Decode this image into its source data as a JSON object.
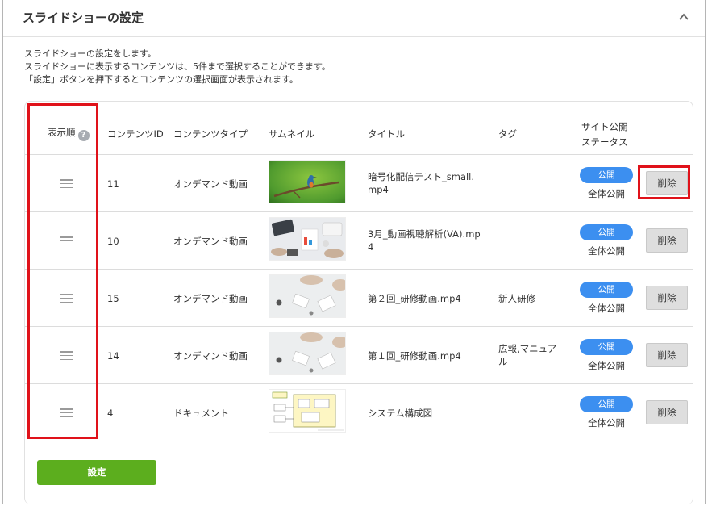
{
  "panel": {
    "title": "スライドショーの設定"
  },
  "description": [
    "スライドショーの設定をします。",
    "スライドショーに表示するコンテンツは、5件まで選択することができます。",
    "「設定」ボタンを押下するとコンテンツの選択画面が表示されます。"
  ],
  "table": {
    "headers": {
      "order": "表示順",
      "help": "?",
      "content_id": "コンテンツID",
      "content_type": "コンテンツタイプ",
      "thumbnail": "サムネイル",
      "title": "タイトル",
      "tag": "タグ",
      "status_line1": "サイト公開",
      "status_line2": "ステータス"
    },
    "rows": [
      {
        "id": "11",
        "type": "オンデマンド動画",
        "thumb": "kingfisher-photo",
        "title_line1": "暗号化配信テスト_small.",
        "title_line2": "mp4",
        "tag_line1": "",
        "tag_line2": "",
        "badge": "公開",
        "status": "全体公開",
        "delete": "削除"
      },
      {
        "id": "10",
        "type": "オンデマンド動画",
        "thumb": "office-desk-photo",
        "title_line1": "3月_動画視聴解析(VA).mp",
        "title_line2": "4",
        "tag_line1": "",
        "tag_line2": "",
        "badge": "公開",
        "status": "全体公開",
        "delete": "削除"
      },
      {
        "id": "15",
        "type": "オンデマンド動画",
        "thumb": "meeting-desk-photo",
        "title_line1": "第２回_研修動画.mp4",
        "title_line2": "",
        "tag_line1": "新人研修",
        "tag_line2": "",
        "badge": "公開",
        "status": "全体公開",
        "delete": "削除"
      },
      {
        "id": "14",
        "type": "オンデマンド動画",
        "thumb": "meeting-desk-photo",
        "title_line1": "第１回_研修動画.mp4",
        "title_line2": "",
        "tag_line1": "広報,マニュア",
        "tag_line2": "ル",
        "badge": "公開",
        "status": "全体公開",
        "delete": "削除"
      },
      {
        "id": "4",
        "type": "ドキュメント",
        "thumb": "system-diagram",
        "title_line1": "システム構成図",
        "title_line2": "",
        "tag_line1": "",
        "tag_line2": "",
        "badge": "公開",
        "status": "全体公開",
        "delete": "削除"
      }
    ]
  },
  "settings_button": "設定",
  "colors": {
    "accent_green": "#5cae1e",
    "badge_blue": "#3c8ff0",
    "highlight_red": "#e0121a"
  }
}
